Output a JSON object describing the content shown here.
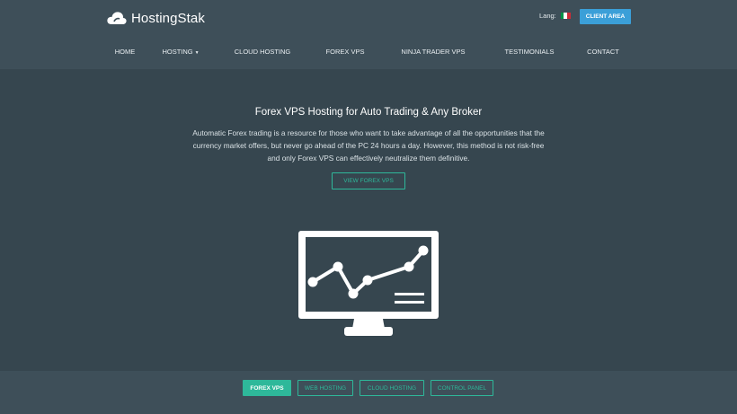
{
  "brand": {
    "name": "HostingStak"
  },
  "header": {
    "lang_label": "Lang:",
    "flag_colors": [
      "#009246",
      "#ffffff",
      "#ce2b37"
    ],
    "client_area_label": "CLIENT AREA"
  },
  "nav": {
    "items": [
      {
        "label": "HOME"
      },
      {
        "label": "HOSTING"
      },
      {
        "label": "CLOUD HOSTING"
      },
      {
        "label": "FOREX VPS"
      },
      {
        "label": "NINJA TRADER VPS"
      },
      {
        "label": "TESTIMONIALS"
      },
      {
        "label": "CONTACT"
      }
    ]
  },
  "hero": {
    "title": "Forex VPS Hosting for Auto Trading & Any Broker",
    "desc_line1": "Automatic Forex trading is a resource for those who want to take advantage of all the opportunities that the",
    "desc_line2": "currency market offers, but never go ahead of the PC 24 hours a day. However, this method is not risk-free",
    "desc_line3": "and only Forex VPS can effectively neutralize them definitive.",
    "button_label": "VIEW FOREX VPS",
    "illustration_icon": "monitor-chart-icon"
  },
  "footer_tabs": [
    {
      "label": "FOREX VPS",
      "active": true
    },
    {
      "label": "WEB HOSTING",
      "active": false
    },
    {
      "label": "CLOUD HOSTING",
      "active": false
    },
    {
      "label": "CONTROL PANEL",
      "active": false
    }
  ],
  "colors": {
    "header_bg": "#3e4f59",
    "body_bg": "#36464f",
    "accent_green": "#2eb89a",
    "accent_blue": "#3b9fd8"
  }
}
